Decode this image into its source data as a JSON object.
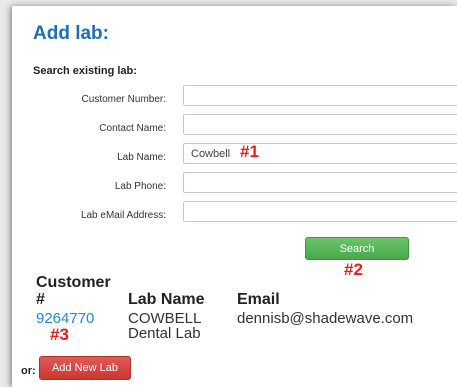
{
  "title": "Add lab:",
  "subtitle": "Search existing lab:",
  "form": {
    "customer_number_label": "Customer Number:",
    "customer_number_value": "",
    "contact_name_label": "Contact Name:",
    "contact_name_value": "",
    "lab_name_label": "Lab Name:",
    "lab_name_value": "Cowbell",
    "lab_phone_label": "Lab Phone:",
    "lab_phone_value": "",
    "lab_email_label": "Lab eMail Address:",
    "lab_email_value": "",
    "search_label": "Search"
  },
  "annotations": {
    "a1": "#1",
    "a2": "#2",
    "a3": "#3"
  },
  "results": {
    "headers": {
      "customer_line1": "Customer",
      "customer_line2": "#",
      "lab_name": "Lab Name",
      "email": "Email"
    },
    "rows": [
      {
        "customer_number": "9264770",
        "lab_name_line1": "COWBELL",
        "lab_name_line2": "Dental Lab",
        "email": "dennisb@shadewave.com"
      }
    ]
  },
  "footer": {
    "or_label": "or:",
    "add_new_lab_label": "Add New Lab"
  },
  "colors": {
    "title": "#1f6fb5",
    "search_button": "#4aa84a",
    "add_button": "#cc3632",
    "annotation": "#e3201b",
    "link": "#2a87c8"
  }
}
